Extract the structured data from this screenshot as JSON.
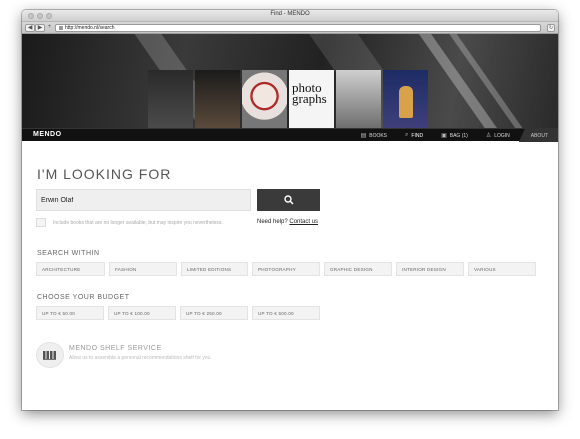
{
  "window": {
    "title": "Find - MENDO"
  },
  "browser": {
    "url": "http://mendo.nl/search",
    "back": "◀",
    "forward": "▶",
    "add": "+",
    "refresh": "↻"
  },
  "hero": {
    "book_photographs_text": "photo graphs"
  },
  "nav": {
    "logo": "MENDO",
    "items": [
      {
        "label": "BOOKS",
        "icon": "book-icon"
      },
      {
        "label": "FIND",
        "icon": "search-icon"
      },
      {
        "label": "BAG (1)",
        "icon": "bag-icon"
      },
      {
        "label": "LOGIN",
        "icon": "user-icon"
      },
      {
        "label": "ABOUT",
        "icon": ""
      }
    ]
  },
  "main": {
    "heading": "I'M LOOKING FOR",
    "search_value": "Erwin Olaf",
    "search_button_icon": "search-icon",
    "include_label": "Include books that are no longer available, but may inspire you nevertheless.",
    "help_text": "Need help?",
    "help_link": "Contact us",
    "search_within_title": "SEARCH WITHIN",
    "search_within": [
      "ARCHITECTURE",
      "FASHION",
      "LIMITED EDITIONS",
      "PHOTOGRAPHY",
      "GRAPHIC DESIGN",
      "INTERIOR DESIGN",
      "VARIOUS"
    ],
    "budget_title": "CHOOSE YOUR BUDGET",
    "budget": [
      "UP TO € 50.00",
      "UP TO € 100.00",
      "UP TO € 250.00",
      "UP TO € 500.00"
    ],
    "shelf_title": "MENDO SHELF SERVICE",
    "shelf_sub": "Allow us to assemble a personal recommendations shelf for you."
  }
}
